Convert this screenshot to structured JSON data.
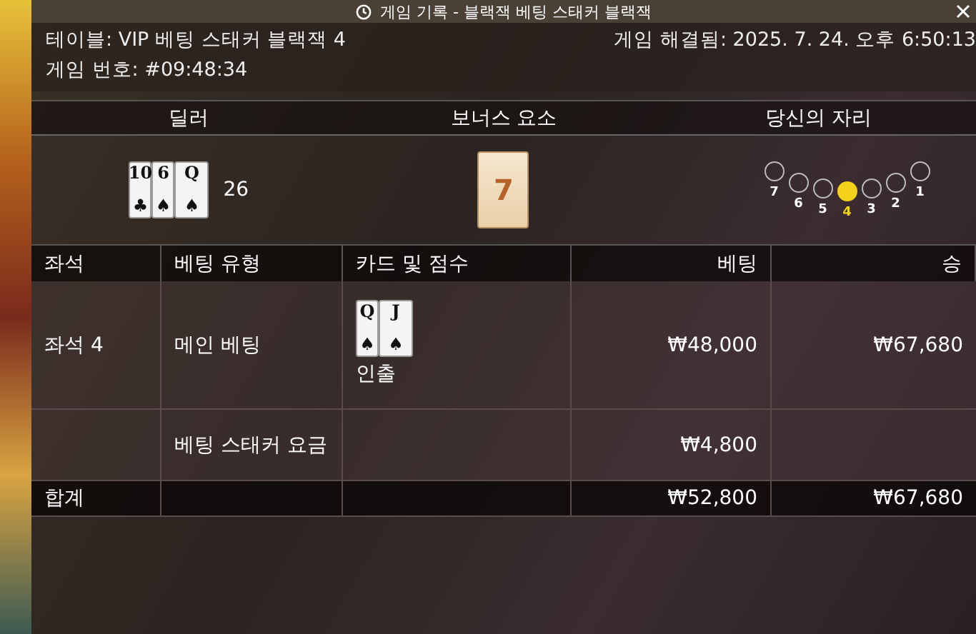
{
  "window": {
    "title": "게임 기록 - 블랙잭 베팅 스태커 블랙잭"
  },
  "info": {
    "table": "테이블: VIP 베팅 스태커 블랙잭 4",
    "resolved": "게임 해결됨: 2025. 7. 24. 오후 6:50:13",
    "game_number": "게임 번호: #09:48:34"
  },
  "summary": {
    "headers": [
      "딜러",
      "보너스 요소",
      "당신의 자리"
    ],
    "dealer": {
      "cards": [
        {
          "rank": "10",
          "suit": "♣"
        },
        {
          "rank": "6",
          "suit": "♠"
        },
        {
          "rank": "Q",
          "suit": "♠"
        }
      ],
      "score": "26"
    },
    "bonus": {
      "value": "7"
    },
    "seats": [
      {
        "label": "7",
        "selected": false
      },
      {
        "label": "6",
        "selected": false
      },
      {
        "label": "5",
        "selected": false
      },
      {
        "label": "4",
        "selected": true
      },
      {
        "label": "3",
        "selected": false
      },
      {
        "label": "2",
        "selected": false
      },
      {
        "label": "1",
        "selected": false
      }
    ]
  },
  "table": {
    "columns": [
      "좌석",
      "베팅 유형",
      "카드 및 점수",
      "베팅",
      "승"
    ],
    "rows": [
      {
        "seat": "좌석 4",
        "bet_type": "메인 베팅",
        "cards": [
          {
            "rank": "Q",
            "suit": "♠"
          },
          {
            "rank": "J",
            "suit": "♠"
          }
        ],
        "result": "인출",
        "bet": "₩48,000",
        "win": "₩67,680"
      },
      {
        "seat": "",
        "bet_type": "베팅 스태커 요금",
        "cards": [],
        "result": "",
        "bet": "₩4,800",
        "win": ""
      }
    ],
    "total": {
      "label": "합계",
      "bet": "₩52,800",
      "win": "₩67,680"
    }
  }
}
